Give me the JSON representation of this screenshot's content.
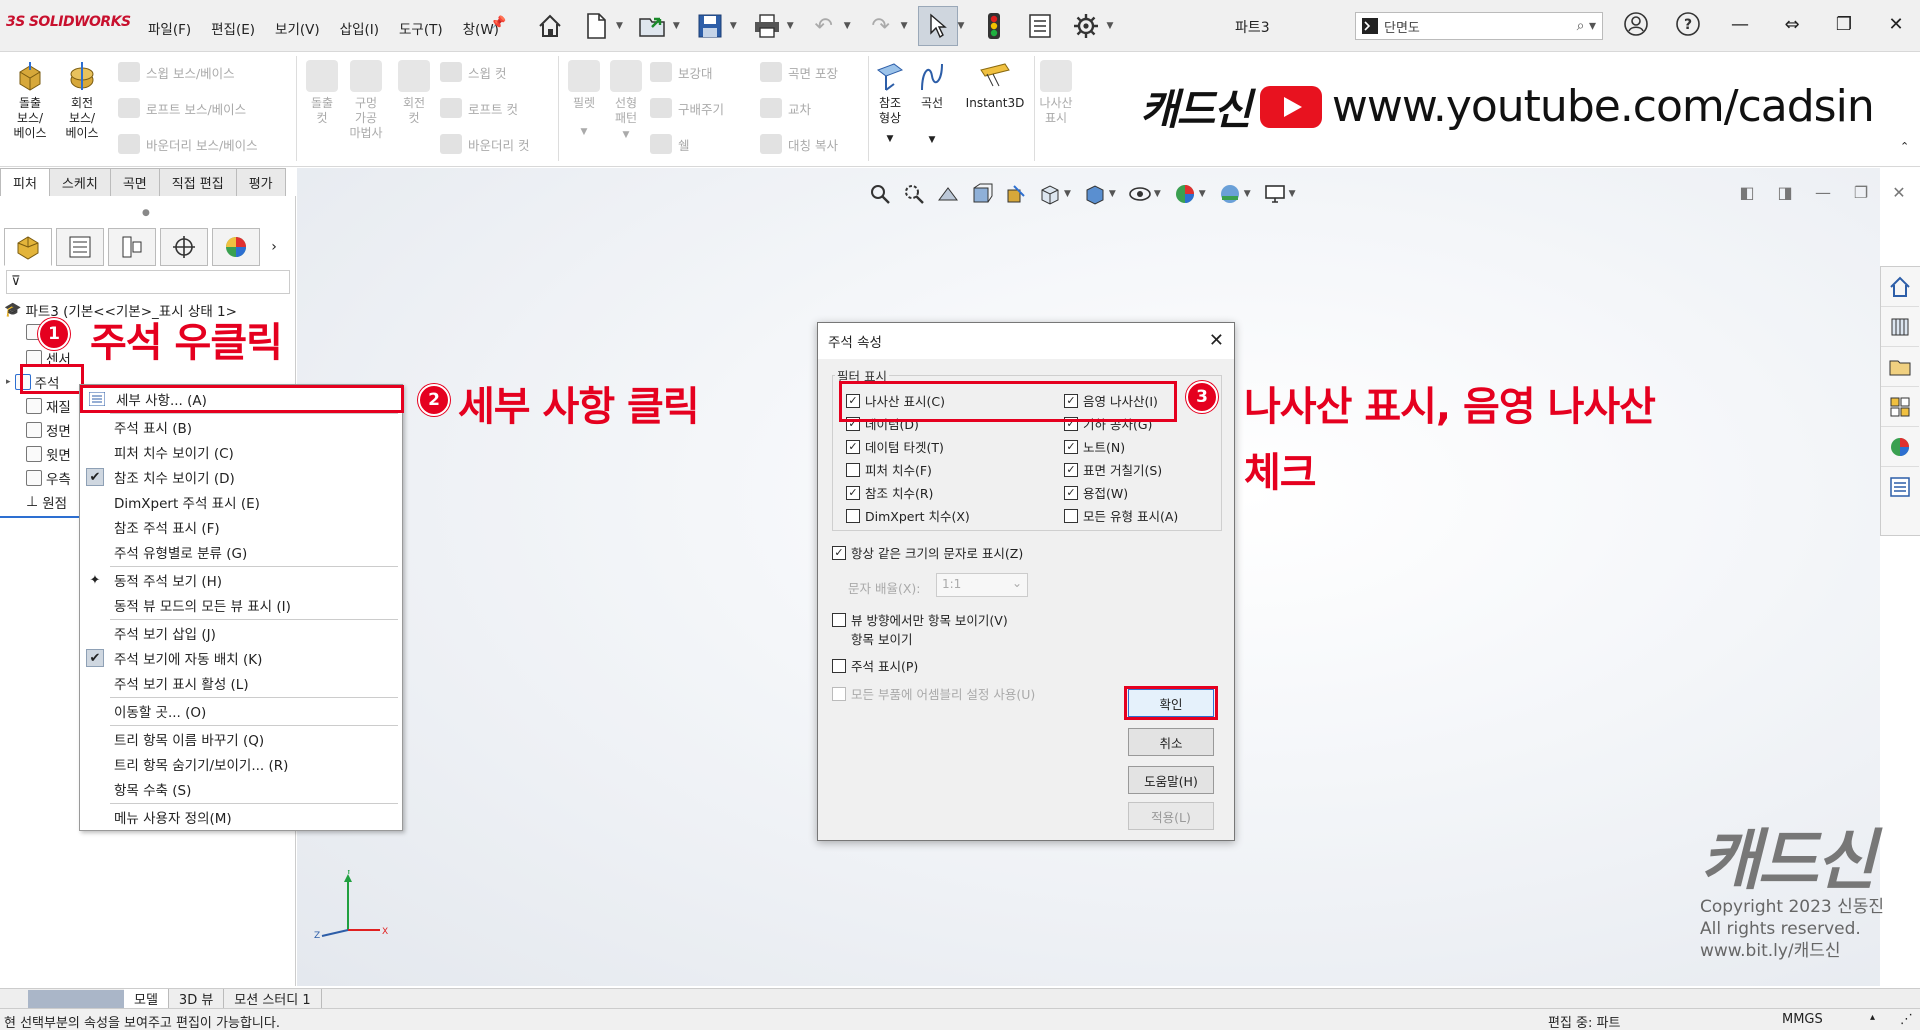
{
  "app": {
    "logo": "SOLIDWORKS",
    "doc_title": "파트3",
    "menu": [
      "파일(F)",
      "편집(E)",
      "보기(V)",
      "삽입(I)",
      "도구(T)",
      "창(W)"
    ],
    "search_placeholder": "단면도"
  },
  "ribbon": {
    "big_buttons": [
      {
        "id": "extrude-boss",
        "label": "돌출\n보스/\n베이스",
        "enabled": true
      },
      {
        "id": "revolve-boss",
        "label": "회전\n보스/\n베이스",
        "enabled": true
      },
      {
        "id": "extrude-cut",
        "label": "돌출\n컷",
        "enabled": false
      },
      {
        "id": "hole-wizard",
        "label": "구멍\n가공\n마법사",
        "enabled": false
      },
      {
        "id": "revolve-cut",
        "label": "회전\n컷",
        "enabled": false
      },
      {
        "id": "fillet",
        "label": "필렛",
        "enabled": false
      },
      {
        "id": "linear-pattern",
        "label": "선형\n패턴",
        "enabled": false
      },
      {
        "id": "ref-geometry",
        "label": "참조\n형상",
        "enabled": true
      },
      {
        "id": "curves",
        "label": "곡선",
        "enabled": true
      },
      {
        "id": "instant3d",
        "label": "Instant3D",
        "enabled": true
      },
      {
        "id": "show-thread",
        "label": "나사산\n표시",
        "enabled": false
      }
    ],
    "small_buttons": [
      {
        "label": "스윕 보스/베이스"
      },
      {
        "label": "로프트 보스/베이스"
      },
      {
        "label": "바운더리 보스/베이스"
      },
      {
        "label": "스윕 컷"
      },
      {
        "label": "로프트 컷"
      },
      {
        "label": "바운더리 컷"
      },
      {
        "label": "보강대"
      },
      {
        "label": "구배주기"
      },
      {
        "label": "쉘"
      },
      {
        "label": "곡면 포장"
      },
      {
        "label": "교차"
      },
      {
        "label": "대칭 복사"
      }
    ],
    "tabs": [
      "피처",
      "스케치",
      "곡면",
      "직접 편집",
      "평가"
    ]
  },
  "watermark": {
    "brand": "캐드신",
    "url": "www.youtube.com/cadsin",
    "brand2": "캐드신",
    "copyright": "Copyright 2023 신동진",
    "rights": "All rights reserved.",
    "site": "www.bit.ly/캐드신"
  },
  "tree": {
    "root": "파트3  (기본<<기본>_표시 상태 1>",
    "items": [
      "주석",
      "재질",
      "정면",
      "윗면",
      "우측",
      "원점"
    ]
  },
  "context_menu": {
    "items": [
      {
        "label": "세부 사항... (A)",
        "icon": "list-icon",
        "checked": false
      },
      {
        "label": "주석 표시 (B)",
        "checked": false
      },
      {
        "label": "피처 치수 보이기 (C)",
        "checked": false
      },
      {
        "label": "참조 치수 보이기 (D)",
        "checked": true
      },
      {
        "label": "DimXpert 주석 표시 (E)",
        "checked": false
      },
      {
        "label": "참조 주석 표시 (F)",
        "checked": false
      },
      {
        "label": "주석 유형별로 분류 (G)",
        "checked": false
      },
      {
        "label": "동적 주석 보기 (H)",
        "icon": "dynamic-view-icon",
        "checked": false
      },
      {
        "label": "동적 뷰 모드의 모든 뷰 표시 (I)",
        "checked": false
      },
      {
        "label": "주석 보기 삽입 (J)",
        "checked": false
      },
      {
        "label": "주석 보기에 자동 배치 (K)",
        "checked": true
      },
      {
        "label": "주석 보기 표시 활성 (L)",
        "checked": false
      },
      {
        "label": "이동할 곳... (O)",
        "checked": false
      },
      {
        "label": "트리 항목 이름 바꾸기 (Q)",
        "checked": false
      },
      {
        "label": "트리 항목 숨기기/보이기... (R)",
        "checked": false
      },
      {
        "label": "항목 수축 (S)",
        "checked": false
      },
      {
        "label": "메뉴 사용자 정의(M)",
        "checked": false
      }
    ]
  },
  "dialog": {
    "title": "주석 속성",
    "group_title": "필터 표시",
    "left_checks": [
      {
        "label": "나사산 표시(C)",
        "checked": true
      },
      {
        "label": "데이텀(D)",
        "checked": true
      },
      {
        "label": "데이텀 타겟(T)",
        "checked": true
      },
      {
        "label": "피처 치수(F)",
        "checked": false
      },
      {
        "label": "참조 치수(R)",
        "checked": true
      },
      {
        "label": "DimXpert 치수(X)",
        "checked": false
      }
    ],
    "right_checks": [
      {
        "label": "음영 나사산(I)",
        "checked": true
      },
      {
        "label": "기하 공차(G)",
        "checked": true
      },
      {
        "label": "노트(N)",
        "checked": true
      },
      {
        "label": "표면 거칠기(S)",
        "checked": true
      },
      {
        "label": "용접(W)",
        "checked": true
      },
      {
        "label": "모든 유형 표시(A)",
        "checked": false
      }
    ],
    "same_size_text": {
      "label": "항상 같은 크기의 문자로 표시(Z)",
      "checked": true
    },
    "text_scale_label": "문자 배율(X):",
    "text_scale_value": "1:1",
    "view_only": {
      "label": "뷰 방향에서만 항목 보이기(V)",
      "checked": false
    },
    "view_only_line2": "항목 보이기",
    "show_annotations": {
      "label": "주석 표시(P)",
      "checked": false
    },
    "assembly_settings": {
      "label": "모든 부품에 어셈블리 설정 사용(U)",
      "checked": false
    },
    "buttons": {
      "ok": "확인",
      "cancel": "취소",
      "help": "도움말(H)",
      "apply": "적용(L)"
    }
  },
  "annotations": {
    "step1": "주석 우클릭",
    "step2": "세부 사항 클릭",
    "step3_line1": "나사산 표시, 음영 나사산",
    "step3_line2": "체크",
    "badges": [
      "1",
      "2",
      "3"
    ]
  },
  "bottom_tabs": [
    "모델",
    "3D 뷰",
    "모션 스터디 1"
  ],
  "status": {
    "left": "현 선택부분의 속성을 보여주고 편집이 가능합니다.",
    "mode": "편집 중: 파트",
    "units": "MMGS"
  },
  "colors": {
    "annotation_red": "#e5001f",
    "accent_blue": "#2d6fd1"
  }
}
